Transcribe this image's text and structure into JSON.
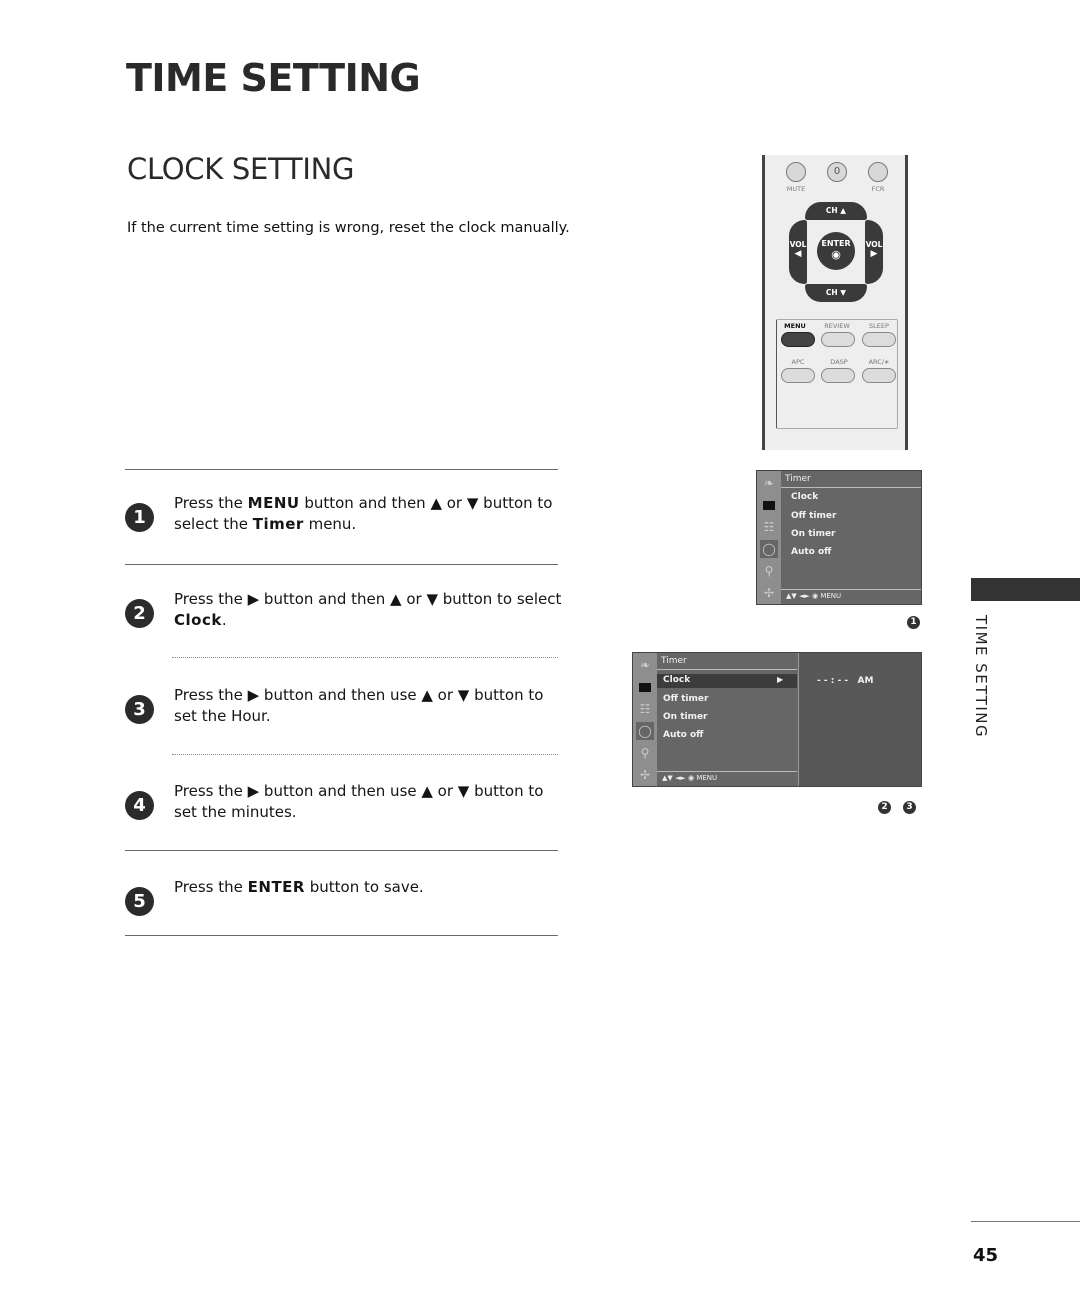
{
  "page": {
    "title": "TIME SETTING",
    "section_title": "CLOCK SETTING",
    "intro": "If the current time setting is wrong, reset the clock manually.",
    "side_label": "TIME SETTING",
    "page_number": "45"
  },
  "steps": [
    {
      "num": "1",
      "parts": [
        "Press the ",
        "MENU",
        " button and then ▲ or ▼ button to select the ",
        "Timer",
        " menu."
      ]
    },
    {
      "num": "2",
      "parts": [
        "Press the ▶ button and then ▲ or ▼ button to select ",
        "Clock",
        "."
      ]
    },
    {
      "num": "3",
      "parts": [
        "Press the ▶ button and then use ▲ or ▼ button to set the Hour."
      ]
    },
    {
      "num": "4",
      "parts": [
        "Press the ▶ button and then use ▲ or ▼ button to set the minutes."
      ]
    },
    {
      "num": "5",
      "parts": [
        "Press the ",
        "ENTER",
        " button to save."
      ]
    }
  ],
  "remote": {
    "top_buttons": [
      {
        "label": "MUTE",
        "glyph": ""
      },
      {
        "label": "",
        "glyph": "0"
      },
      {
        "label": "FCR",
        "glyph": ""
      }
    ],
    "ch_up": "CH ▲",
    "ch_down": "CH ▼",
    "vol_left": "VOL",
    "vol_right": "VOL",
    "enter": "ENTER",
    "row1": [
      "MENU",
      "REVIEW",
      "SLEEP"
    ],
    "row2": [
      "APC",
      "DASP",
      "ARC/∗"
    ]
  },
  "osd1": {
    "title": "Timer",
    "items": [
      "Clock",
      "Off timer",
      "On timer",
      "Auto off"
    ],
    "footer": "▲▼   ◄►   ◉   MENU",
    "caption_nums": [
      "1"
    ]
  },
  "osd2": {
    "title": "Timer",
    "items": [
      "Clock",
      "Off timer",
      "On timer",
      "Auto off"
    ],
    "selected_arrow": "▶",
    "footer": "▲▼   ◄►   ◉   MENU",
    "value": "- - : - -   AM",
    "caption_nums": [
      "2",
      "3"
    ]
  },
  "osd_icons": [
    "satellite-dish-icon",
    "picture-icon",
    "speaker-icon",
    "clock-icon",
    "key-icon",
    "tools-icon"
  ]
}
